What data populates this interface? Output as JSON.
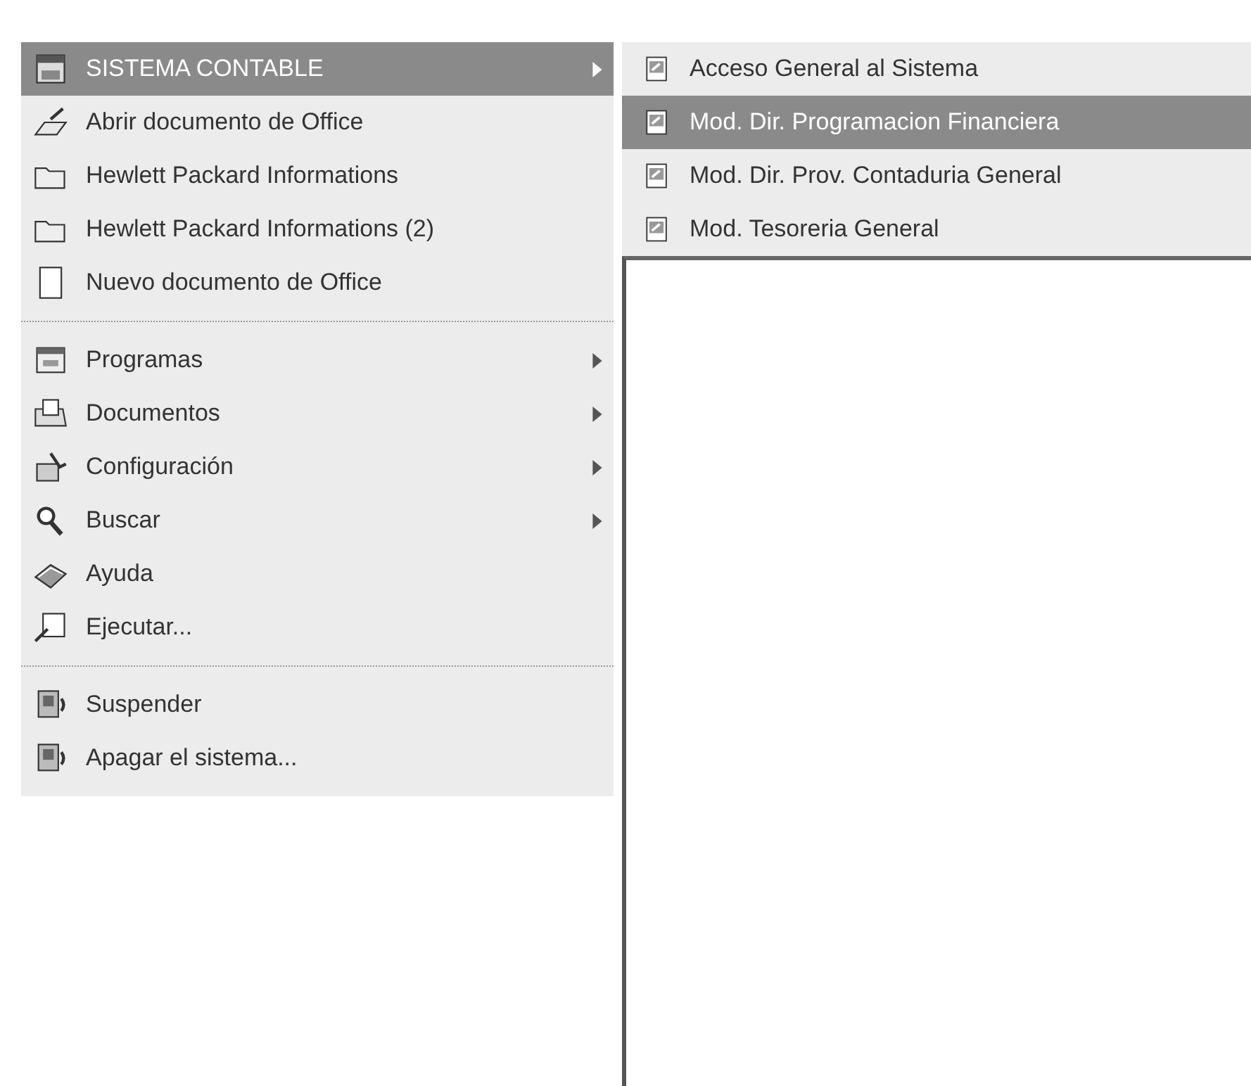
{
  "start_menu": {
    "groups": [
      {
        "items": [
          {
            "label": "SISTEMA CONTABLE",
            "selected": true,
            "has_submenu": true
          },
          {
            "label": "Abrir documento de Office",
            "selected": false,
            "has_submenu": false
          },
          {
            "label": "Hewlett Packard Informations",
            "selected": false,
            "has_submenu": false
          },
          {
            "label": "Hewlett Packard Informations (2)",
            "selected": false,
            "has_submenu": false
          },
          {
            "label": "Nuevo documento de Office",
            "selected": false,
            "has_submenu": false
          }
        ]
      },
      {
        "items": [
          {
            "label": "Programas",
            "selected": false,
            "has_submenu": true
          },
          {
            "label": "Documentos",
            "selected": false,
            "has_submenu": true
          },
          {
            "label": "Configuración",
            "selected": false,
            "has_submenu": true
          },
          {
            "label": "Buscar",
            "selected": false,
            "has_submenu": true
          },
          {
            "label": "Ayuda",
            "selected": false,
            "has_submenu": false
          },
          {
            "label": "Ejecutar...",
            "selected": false,
            "has_submenu": false
          }
        ]
      },
      {
        "items": [
          {
            "label": "Suspender",
            "selected": false,
            "has_submenu": false
          },
          {
            "label": "Apagar el sistema...",
            "selected": false,
            "has_submenu": false
          }
        ]
      }
    ]
  },
  "submenu": {
    "items": [
      {
        "label": "Acceso General al Sistema",
        "selected": false
      },
      {
        "label": "Mod. Dir. Programacion Financiera",
        "selected": true
      },
      {
        "label": "Mod. Dir. Prov. Contaduria General",
        "selected": false
      },
      {
        "label": "Mod. Tesoreria General",
        "selected": false
      }
    ]
  }
}
